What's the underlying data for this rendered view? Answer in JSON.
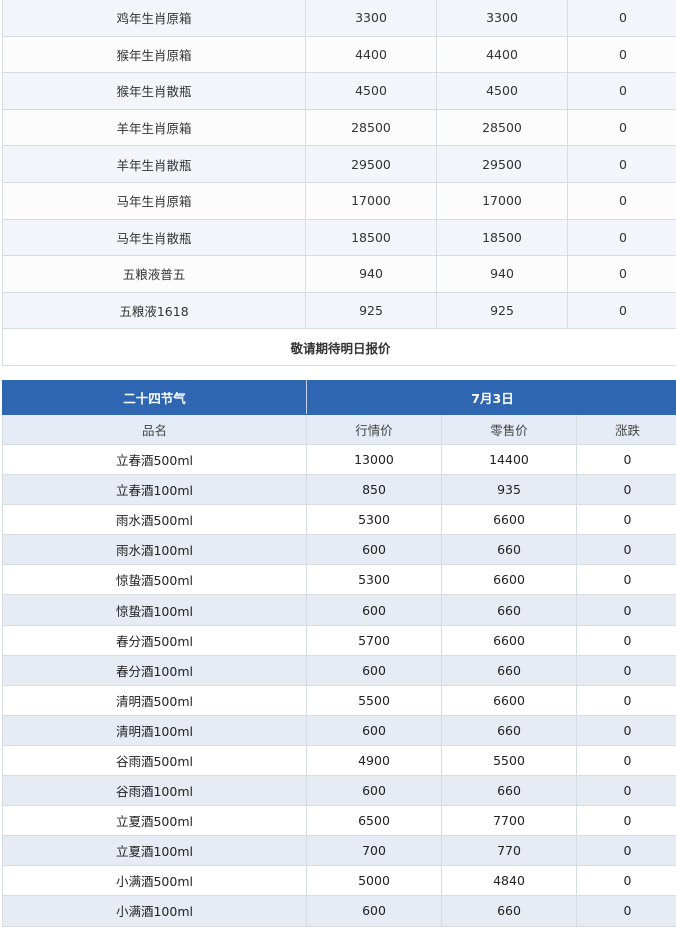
{
  "table1": {
    "rows": [
      {
        "name": "鸡年生肖原箱",
        "market": "3300",
        "retail": "3300",
        "change": "0"
      },
      {
        "name": "猴年生肖原箱",
        "market": "4400",
        "retail": "4400",
        "change": "0"
      },
      {
        "name": "猴年生肖散瓶",
        "market": "4500",
        "retail": "4500",
        "change": "0"
      },
      {
        "name": "羊年生肖原箱",
        "market": "28500",
        "retail": "28500",
        "change": "0"
      },
      {
        "name": "羊年生肖散瓶",
        "market": "29500",
        "retail": "29500",
        "change": "0"
      },
      {
        "name": "马年生肖原箱",
        "market": "17000",
        "retail": "17000",
        "change": "0"
      },
      {
        "name": "马年生肖散瓶",
        "market": "18500",
        "retail": "18500",
        "change": "0"
      },
      {
        "name": "五粮液普五",
        "market": "940",
        "retail": "940",
        "change": "0"
      },
      {
        "name": "五粮液1618",
        "market": "925",
        "retail": "925",
        "change": "0"
      }
    ],
    "note": "敬请期待明日报价"
  },
  "table2": {
    "title": "二十四节气",
    "date": "7月3日",
    "columns": {
      "name": "品名",
      "market": "行情价",
      "retail": "零售价",
      "change": "涨跌"
    },
    "rows": [
      {
        "name": "立春酒500ml",
        "market": "13000",
        "retail": "14400",
        "change": "0"
      },
      {
        "name": "立春酒100ml",
        "market": "850",
        "retail": "935",
        "change": "0"
      },
      {
        "name": "雨水酒500ml",
        "market": "5300",
        "retail": "6600",
        "change": "0"
      },
      {
        "name": "雨水酒100ml",
        "market": "600",
        "retail": "660",
        "change": "0"
      },
      {
        "name": "惊蛰酒500ml",
        "market": "5300",
        "retail": "6600",
        "change": "0"
      },
      {
        "name": "惊蛰酒100ml",
        "market": "600",
        "retail": "660",
        "change": "0"
      },
      {
        "name": "春分酒500ml",
        "market": "5700",
        "retail": "6600",
        "change": "0"
      },
      {
        "name": "春分酒100ml",
        "market": "600",
        "retail": "660",
        "change": "0"
      },
      {
        "name": "清明酒500ml",
        "market": "5500",
        "retail": "6600",
        "change": "0"
      },
      {
        "name": "清明酒100ml",
        "market": "600",
        "retail": "660",
        "change": "0"
      },
      {
        "name": "谷雨酒500ml",
        "market": "4900",
        "retail": "5500",
        "change": "0"
      },
      {
        "name": "谷雨酒100ml",
        "market": "600",
        "retail": "660",
        "change": "0"
      },
      {
        "name": "立夏酒500ml",
        "market": "6500",
        "retail": "7700",
        "change": "0"
      },
      {
        "name": "立夏酒100ml",
        "market": "700",
        "retail": "770",
        "change": "0"
      },
      {
        "name": "小满酒500ml",
        "market": "5000",
        "retail": "4840",
        "change": "0"
      },
      {
        "name": "小满酒100ml",
        "market": "600",
        "retail": "660",
        "change": "0"
      }
    ]
  }
}
